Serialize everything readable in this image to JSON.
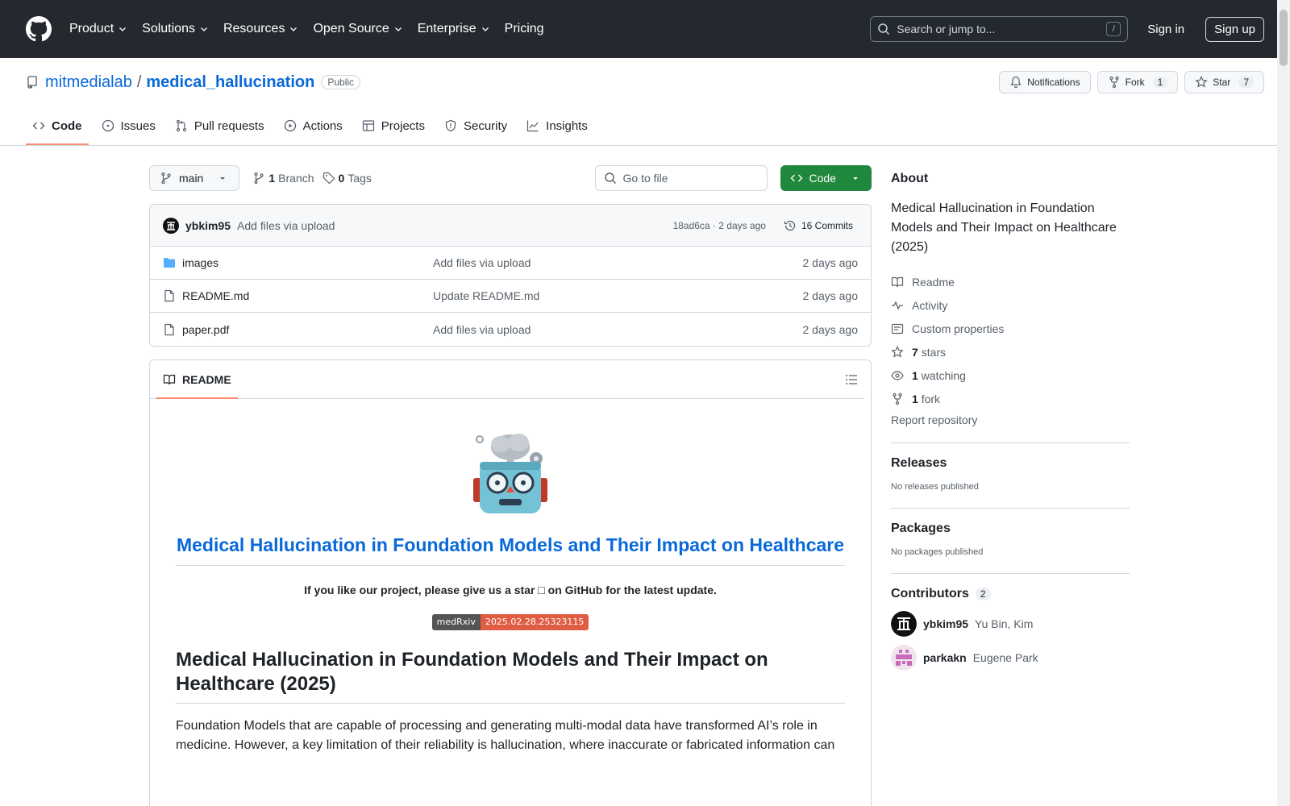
{
  "header": {
    "nav": [
      {
        "label": "Product",
        "dropdown": true
      },
      {
        "label": "Solutions",
        "dropdown": true
      },
      {
        "label": "Resources",
        "dropdown": true
      },
      {
        "label": "Open Source",
        "dropdown": true
      },
      {
        "label": "Enterprise",
        "dropdown": true
      },
      {
        "label": "Pricing",
        "dropdown": false
      }
    ],
    "search_placeholder": "Search or jump to...",
    "search_key": "/",
    "sign_in": "Sign in",
    "sign_up": "Sign up"
  },
  "repo": {
    "owner": "mitmedialab",
    "separator": "/",
    "name": "medical_hallucination",
    "visibility": "Public",
    "notifications_label": "Notifications",
    "fork_label": "Fork",
    "fork_count": "1",
    "star_label": "Star",
    "star_count": "7",
    "tabs": [
      "Code",
      "Issues",
      "Pull requests",
      "Actions",
      "Projects",
      "Security",
      "Insights"
    ]
  },
  "filenav": {
    "branch": "main",
    "branch_count": "1",
    "branch_label": "Branch",
    "tag_count": "0",
    "tag_label": "Tags",
    "goto_placeholder": "Go to file",
    "code_label": "Code"
  },
  "commit": {
    "author": "ybkim95",
    "message": "Add files via upload",
    "meta": "18ad6ca · 2 days ago",
    "commits_label": "16 Commits"
  },
  "files": [
    {
      "name": "images",
      "type": "folder",
      "message": "Add files via upload",
      "date": "2 days ago"
    },
    {
      "name": "README.md",
      "type": "file",
      "message": "Update README.md",
      "date": "2 days ago"
    },
    {
      "name": "paper.pdf",
      "type": "file",
      "message": "Add files via upload",
      "date": "2 days ago"
    }
  ],
  "readme": {
    "tab_label": "README",
    "title": "Medical Hallucination in Foundation Models and Their Impact on Healthcare",
    "star_note": "If you like our project, please give us a star □ on GitHub for the latest update.",
    "badge_left": "medRxiv",
    "badge_right": "2025.02.28.25323115",
    "h2": "Medical Hallucination in Foundation Models and Their Impact on Healthcare (2025)",
    "paragraph": "Foundation Models that are capable of processing and generating multi-modal data have transformed AI’s role in medicine. However, a key limitation of their reliability is hallucination, where inaccurate or fabricated information can"
  },
  "about": {
    "heading": "About",
    "description": "Medical Hallucination in Foundation Models and Their Impact on Healthcare (2025)",
    "readme": "Readme",
    "activity": "Activity",
    "custom_properties": "Custom properties",
    "stars_count": "7",
    "stars_label": "stars",
    "watching_count": "1",
    "watching_label": "watching",
    "fork_count": "1",
    "fork_label": "fork",
    "report": "Report repository"
  },
  "releases": {
    "heading": "Releases",
    "note": "No releases published"
  },
  "packages": {
    "heading": "Packages",
    "note": "No packages published"
  },
  "contributors": {
    "heading": "Contributors",
    "count": "2",
    "list": [
      {
        "login": "ybkim95",
        "name": "Yu Bin, Kim"
      },
      {
        "login": "parkakn",
        "name": "Eugene Park"
      }
    ]
  }
}
